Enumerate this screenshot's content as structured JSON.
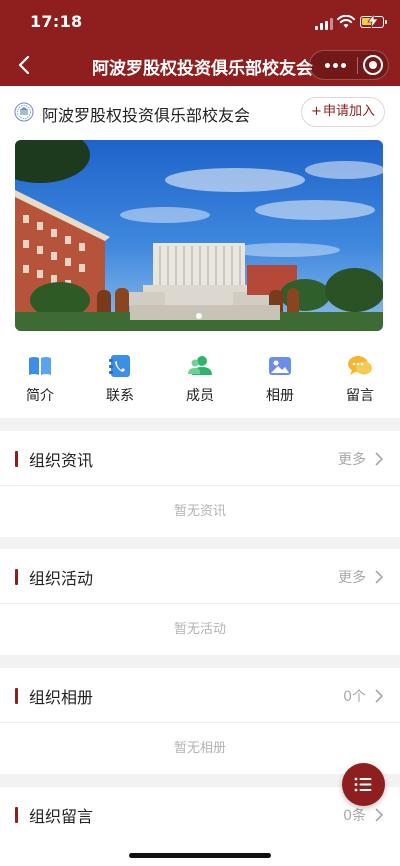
{
  "status_bar": {
    "time": "17:18"
  },
  "nav": {
    "title": "阿波罗股权投资俱乐部校友会"
  },
  "org": {
    "name": "阿波罗股权投资俱乐部校友会",
    "join_label": "申请加入"
  },
  "banner": {
    "total_slides": 1,
    "active_slide": 1
  },
  "quick_links": [
    {
      "label": "简介",
      "icon": "book-icon",
      "color": "#3d8fe6"
    },
    {
      "label": "联系",
      "icon": "phone-book-icon",
      "color": "#3d8fe6"
    },
    {
      "label": "成员",
      "icon": "members-icon",
      "color": "#2fb56b"
    },
    {
      "label": "相册",
      "icon": "photo-album-icon",
      "color": "#6b8fe8"
    },
    {
      "label": "留言",
      "icon": "chat-bubbles-icon",
      "color": "#f5b62b"
    }
  ],
  "sections": [
    {
      "title": "组织资讯",
      "more": "更多",
      "empty": "暂无资讯"
    },
    {
      "title": "组织活动",
      "more": "更多",
      "empty": "暂无活动"
    },
    {
      "title": "组织相册",
      "more": "0个",
      "empty": "暂无相册"
    },
    {
      "title": "组织留言",
      "more": "0条"
    }
  ],
  "colors": {
    "brand": "#8f1e1e",
    "muted": "#a8a8a8"
  }
}
